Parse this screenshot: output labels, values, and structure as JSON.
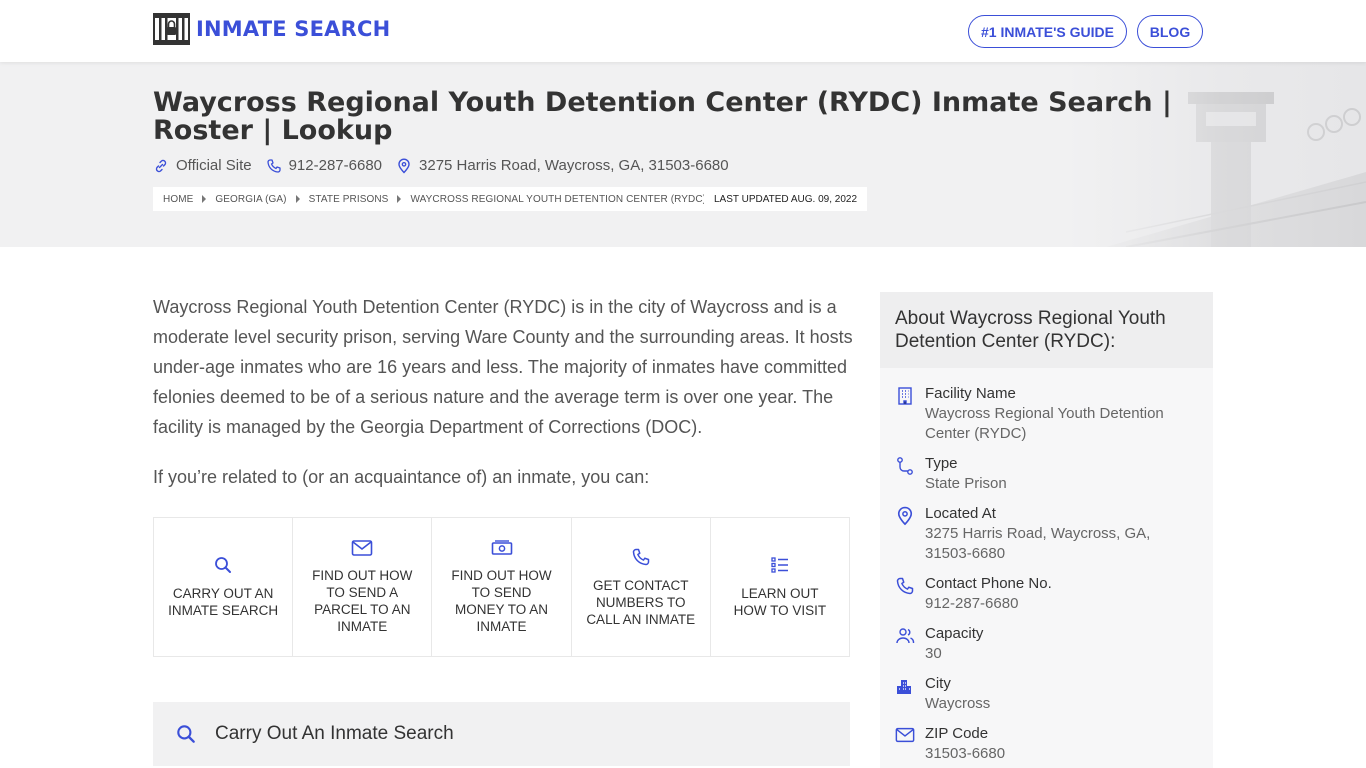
{
  "header": {
    "logo_text": "INMATE SEARCH",
    "nav": [
      {
        "label": "#1 INMATE'S GUIDE"
      },
      {
        "label": "BLOG"
      }
    ]
  },
  "hero": {
    "title": "Waycross Regional Youth Detention Center (RYDC) Inmate Search | Roster | Lookup",
    "official_site": "Official Site",
    "phone": "912-287-6680",
    "address": "3275 Harris Road, Waycross, GA, 31503-6680",
    "breadcrumbs": [
      "HOME",
      "GEORGIA (GA)",
      "STATE PRISONS",
      "WAYCROSS REGIONAL YOUTH DETENTION CENTER (RYDC)"
    ],
    "last_updated": "LAST UPDATED AUG. 09, 2022"
  },
  "main": {
    "intro": "Waycross Regional Youth Detention Center (RYDC) is in the city of Waycross and is a moderate level security prison, serving Ware County and the surrounding areas. It hosts under-age inmates who are 16 years and less. The majority of inmates have committed felonies deemed to be of a serious nature and the average term is over one year. The facility is managed by the Georgia Department of Corrections (DOC).",
    "intro2": "If you’re related to (or an acquaintance of) an inmate, you can:",
    "actions": [
      {
        "label": "CARRY OUT AN INMATE SEARCH",
        "icon": "search-icon"
      },
      {
        "label": "FIND OUT HOW TO SEND A PARCEL TO AN INMATE",
        "icon": "envelope-icon"
      },
      {
        "label": "FIND OUT HOW TO SEND MONEY TO AN INMATE",
        "icon": "money-icon"
      },
      {
        "label": "GET CONTACT NUMBERS TO CALL AN INMATE",
        "icon": "phone-icon"
      },
      {
        "label": "LEARN OUT HOW TO VISIT",
        "icon": "list-icon"
      }
    ],
    "search_section_title": "Carry Out An Inmate Search"
  },
  "sidebar": {
    "title": "About Waycross Regional Youth Detention Center (RYDC):",
    "items": [
      {
        "key": "Facility Name",
        "value": "Waycross Regional Youth Detention Center (RYDC)",
        "icon": "building-icon"
      },
      {
        "key": "Type",
        "value": "State Prison",
        "icon": "route-icon"
      },
      {
        "key": "Located At",
        "value": "3275 Harris Road, Waycross, GA, 31503-6680",
        "icon": "location-pin-icon"
      },
      {
        "key": "Contact Phone No.",
        "value": "912-287-6680",
        "icon": "phone-icon"
      },
      {
        "key": "Capacity",
        "value": "30",
        "icon": "users-icon"
      },
      {
        "key": "City",
        "value": "Waycross",
        "icon": "city-icon"
      },
      {
        "key": "ZIP Code",
        "value": "31503-6680",
        "icon": "envelope-icon"
      }
    ]
  },
  "colors": {
    "brand": "#3b4fd8",
    "hero_bg": "#f1f1f2",
    "sidebar_bg": "#f7f7f8"
  }
}
